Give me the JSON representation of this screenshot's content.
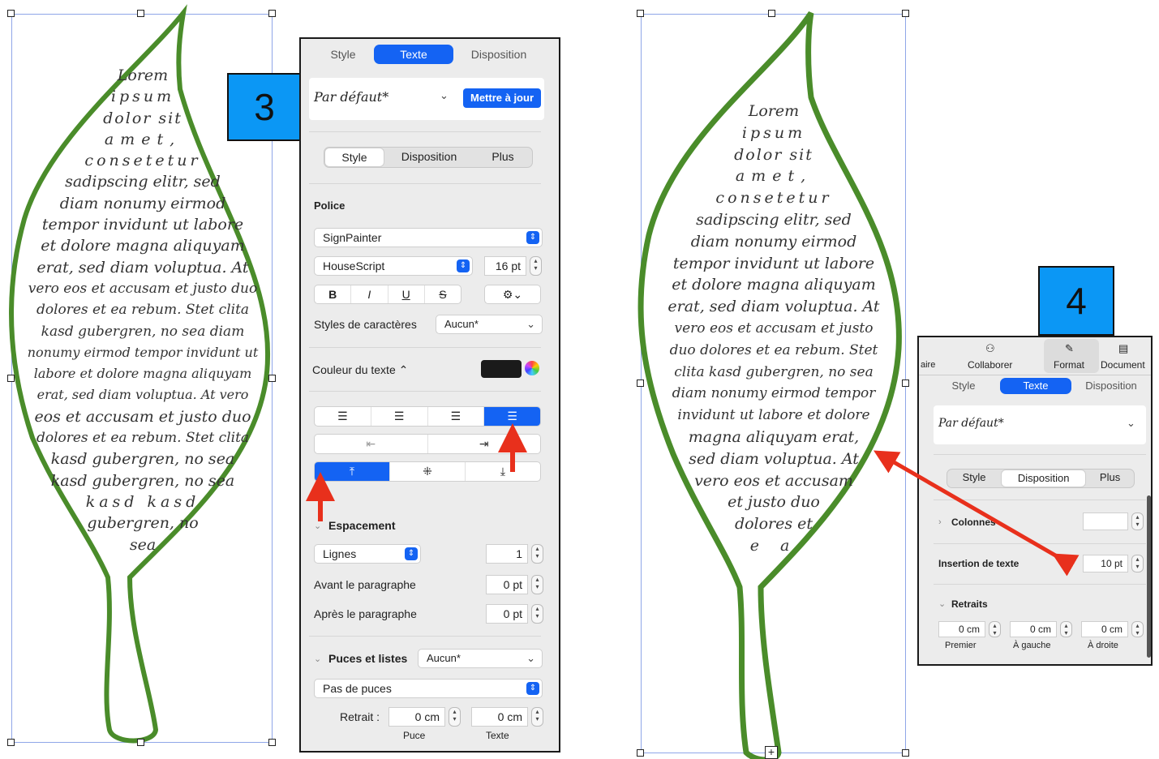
{
  "badges": {
    "left": "3",
    "right": "4"
  },
  "leaf_text_left": [
    "Lorem",
    "ipsum",
    "dolor sit",
    "amet,",
    "consetetur",
    "sadipscing elitr, sed",
    "diam nonumy eirmod",
    "tempor invidunt ut labore",
    "et dolore magna aliquyam",
    "erat, sed diam voluptua. At",
    "vero eos et accusam et justo duo",
    "dolores et ea rebum. Stet clita",
    "kasd gubergren, no sea diam",
    "nonumy eirmod tempor invidunt ut",
    "labore et dolore magna aliquyam",
    "erat, sed diam voluptua. At vero",
    "eos et accusam et justo duo",
    "dolores et ea rebum. Stet clita",
    "kasd gubergren, no sea",
    "kasd gubergren, no sea",
    "kasd kasd",
    "gubergren, no",
    "sea"
  ],
  "leaf_text_right": [
    "Lorem",
    "ipsum",
    "dolor sit",
    "amet,",
    "consetetur",
    "sadipscing elitr, sed",
    "diam nonumy eirmod",
    "tempor invidunt ut labore",
    "et dolore magna aliquyam",
    "erat, sed diam voluptua. At",
    "vero eos et accusam et justo",
    "duo dolores et ea rebum. Stet",
    "clita kasd gubergren, no sea",
    "diam nonumy eirmod tempor",
    "invidunt ut labore et dolore",
    "magna aliquyam erat,",
    "sed diam voluptua. At",
    "vero eos et accusam",
    "et justo duo",
    "dolores et",
    "e a"
  ],
  "panel3": {
    "tabs": [
      "Style",
      "Texte",
      "Disposition"
    ],
    "style_name": "Par défaut*",
    "update_button": "Mettre à jour",
    "subtabs": [
      "Style",
      "Disposition",
      "Plus"
    ],
    "police_label": "Police",
    "font_family": "SignPainter",
    "font_face": "HouseScript",
    "font_size": "16 pt",
    "format_buttons": [
      "B",
      "I",
      "U",
      "S"
    ],
    "char_styles_label": "Styles de caractères",
    "char_styles_value": "Aucun*",
    "text_color_label": "Couleur du texte ⌃",
    "spacing_label": "Espacement",
    "lines_label": "Lignes",
    "lines_value": "1",
    "before_label": "Avant le paragraphe",
    "before_value": "0 pt",
    "after_label": "Après le paragraphe",
    "after_value": "0 pt",
    "bullets_label": "Puces et listes",
    "bullets_value": "Aucun*",
    "bullet_type": "Pas de puces",
    "retrait_label": "Retrait :",
    "retrait_puce": "0 cm",
    "retrait_texte": "0 cm",
    "puce_label": "Puce",
    "texte_label": "Texte",
    "colors": {
      "accent": "#1463f3",
      "text_color_swatch": "#1a1a1a"
    }
  },
  "panel4": {
    "toolbar": [
      "aire",
      "Collaborer",
      "Format",
      "Document"
    ],
    "tabs": [
      "Style",
      "Texte",
      "Disposition"
    ],
    "style_name": "Par défaut*",
    "subtabs": [
      "Style",
      "Disposition",
      "Plus"
    ],
    "columns_label": "Colonnes",
    "insertion_label": "Insertion de texte",
    "insertion_value": "10 pt",
    "retraits_label": "Retraits",
    "premier_value": "0 cm",
    "gauche_value": "0 cm",
    "droite_value": "0 cm",
    "premier_label": "Premier",
    "gauche_label": "À gauche",
    "droite_label": "À droite"
  },
  "colors": {
    "leaf_stroke": "#4a8c2a",
    "arrow": "#e8301c",
    "badge": "#0b97f5"
  }
}
